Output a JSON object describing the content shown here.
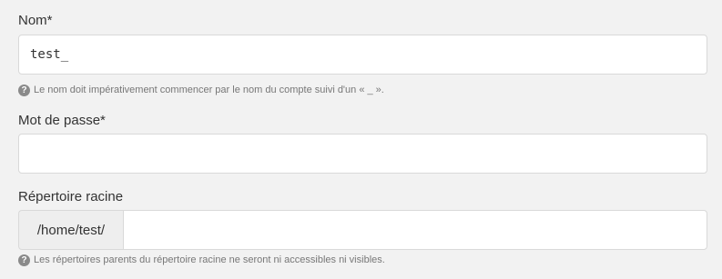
{
  "fields": {
    "name": {
      "label": "Nom*",
      "value": "test_",
      "help": "Le nom doit impérativement commencer par le nom du compte suivi d'un « _ »."
    },
    "password": {
      "label": "Mot de passe*",
      "value": ""
    },
    "root_dir": {
      "label": "Répertoire racine",
      "prefix": "/home/test/",
      "value": "",
      "help": "Les répertoires parents du répertoire racine ne seront ni accessibles ni visibles."
    }
  },
  "icons": {
    "help": "question-circle-icon",
    "help_glyph": "?"
  }
}
